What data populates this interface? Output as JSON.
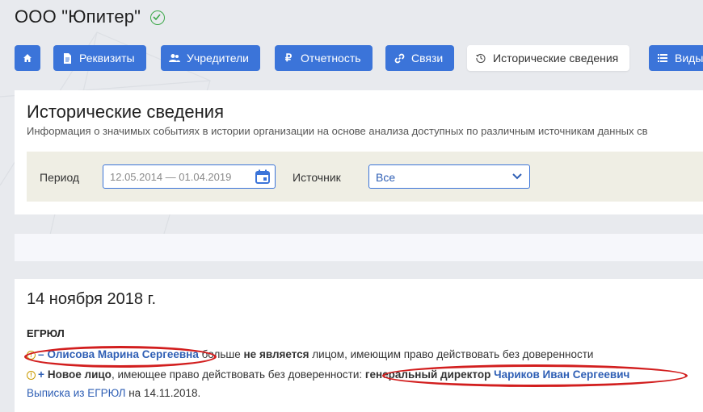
{
  "company": {
    "name": "ООО \"Юпитер\""
  },
  "tabs": [
    {
      "label": "",
      "icon": "home-icon"
    },
    {
      "label": "Реквизиты",
      "icon": "document-icon"
    },
    {
      "label": "Учредители",
      "icon": "users-icon"
    },
    {
      "label": "Отчетность",
      "icon": "ruble-icon"
    },
    {
      "label": "Связи",
      "icon": "link-icon"
    },
    {
      "label": "Исторические сведения",
      "icon": "history-icon",
      "active": true
    },
    {
      "label": "Виды",
      "icon": "list-icon"
    }
  ],
  "history": {
    "title": "Исторические сведения",
    "subtitle": "Информация о значимых событиях в истории организации на основе анализа доступных по различным источникам данных св",
    "filters": {
      "period_label": "Период",
      "period_value": "12.05.2014 — 01.04.2019",
      "source_label": "Источник",
      "source_value": "Все"
    }
  },
  "event": {
    "date": "14 ноября 2018 г.",
    "source": "ЕГРЮЛ",
    "line1": {
      "sign": "–",
      "person": "Олисова Марина Сергеевна",
      "text1": " больше ",
      "bold": "не является",
      "text2": " лицом, имеющим право действовать без доверенности"
    },
    "line2": {
      "sign": "+",
      "bold": "Новое лицо",
      "text1": ", имеющее право действовать без доверенности: ",
      "role": "генеральный директор",
      "person": "Чариков Иван Сергеевич"
    },
    "line3": {
      "link": "Выписка из ЕГРЮЛ",
      "text": " на 14.11.2018."
    }
  },
  "colors": {
    "accent": "#3b74d9",
    "link": "#2f5fb5",
    "verified": "#3da84a",
    "annotation": "#d21e1e",
    "filter_bg": "#efeee4"
  }
}
